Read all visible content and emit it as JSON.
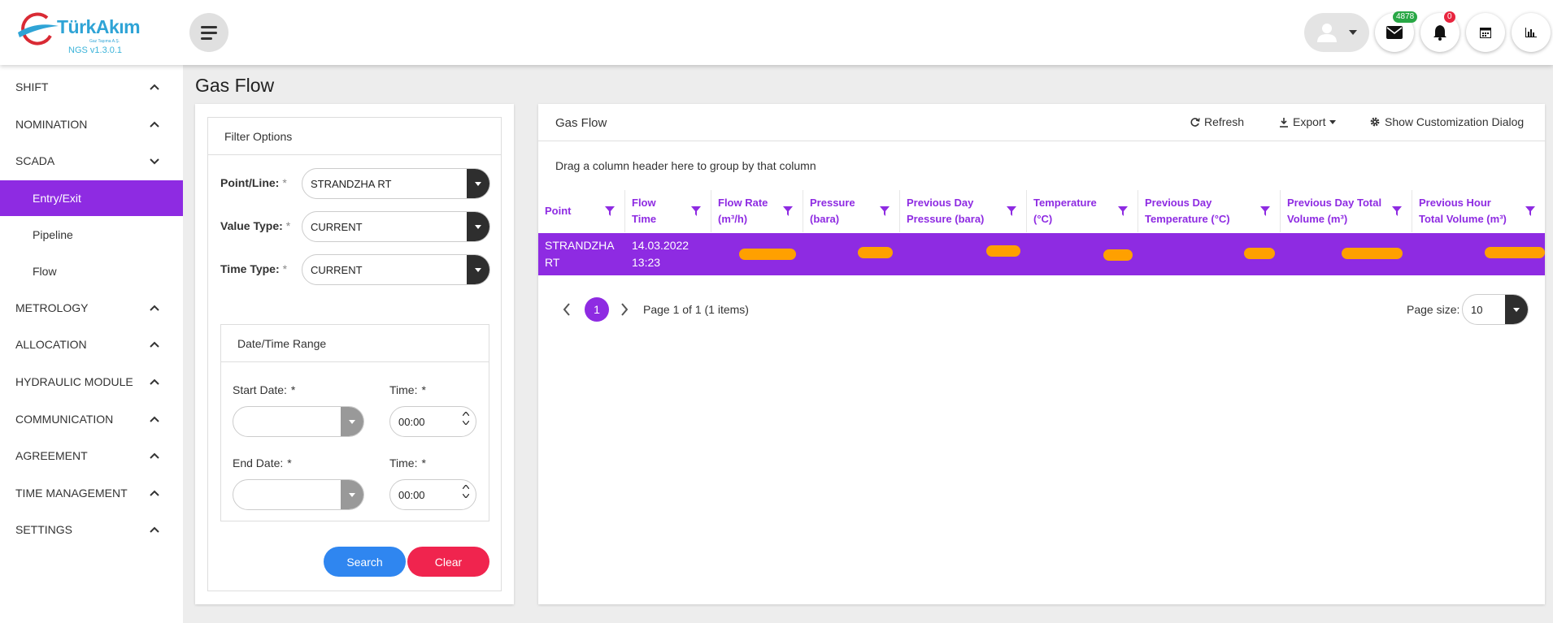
{
  "app": {
    "logo_text": "TürkAkım",
    "logo_sub": "Gaz Taşıma A.Ş.",
    "version": "NGS v1.3.0.1"
  },
  "header": {
    "mail_count": "4878",
    "notification_count": "0"
  },
  "sidebar": {
    "items": [
      {
        "label": "SHIFT",
        "expanded": false
      },
      {
        "label": "NOMINATION",
        "expanded": false
      },
      {
        "label": "SCADA",
        "expanded": true
      },
      {
        "label": "Entry/Exit",
        "sub": true,
        "active": true
      },
      {
        "label": "Pipeline",
        "sub": true
      },
      {
        "label": "Flow",
        "sub": true
      },
      {
        "label": "METROLOGY",
        "expanded": false
      },
      {
        "label": "ALLOCATION",
        "expanded": false
      },
      {
        "label": "HYDRAULIC MODULE",
        "expanded": false
      },
      {
        "label": "COMMUNICATION",
        "expanded": false
      },
      {
        "label": "AGREEMENT",
        "expanded": false
      },
      {
        "label": "TIME MANAGEMENT",
        "expanded": false
      },
      {
        "label": "SETTINGS",
        "expanded": false
      }
    ]
  },
  "page": {
    "title": "Gas Flow"
  },
  "filter": {
    "title": "Filter Options",
    "point_label": "Point/Line:",
    "point_value": "STRANDZHA RT",
    "value_type_label": "Value Type:",
    "value_type_value": "CURRENT",
    "time_type_label": "Time Type:",
    "time_type_value": "CURRENT",
    "required_mark": "*",
    "range": {
      "title": "Date/Time Range",
      "start_date_label": "Start Date:",
      "end_date_label": "End Date:",
      "time_label": "Time:",
      "start_date_value": "",
      "end_date_value": "",
      "start_time_value": "00:00",
      "end_time_value": "00:00"
    },
    "search_label": "Search",
    "clear_label": "Clear"
  },
  "grid": {
    "title": "Gas Flow",
    "refresh_label": "Refresh",
    "export_label": "Export",
    "customize_label": "Show Customization Dialog",
    "group_hint": "Drag a column header here to group by that column",
    "columns": [
      [
        "Point"
      ],
      [
        "Flow",
        "Time"
      ],
      [
        "Flow Rate",
        "(m³/h)"
      ],
      [
        "Pressure",
        "(bara)"
      ],
      [
        "Previous Day",
        "Pressure (bara)"
      ],
      [
        "Temperature",
        "(°C)"
      ],
      [
        "Previous Day",
        "Temperature (°C)"
      ],
      [
        "Previous Day Total",
        "Volume (m³)"
      ],
      [
        "Previous Hour",
        "Total Volume (m³)"
      ]
    ],
    "row": {
      "point": [
        "STRANDZHA",
        "RT"
      ],
      "flow_time": [
        "14.03.2022",
        "13:23"
      ]
    },
    "pager": {
      "current_page": "1",
      "info": "Page 1 of 1 (1 items)",
      "page_size_label": "Page size:",
      "page_size": "10"
    }
  },
  "colors": {
    "accent": "#8e2be2",
    "search": "#2f86f0",
    "clear": "#f0244e",
    "redaction": "#ffa000"
  }
}
